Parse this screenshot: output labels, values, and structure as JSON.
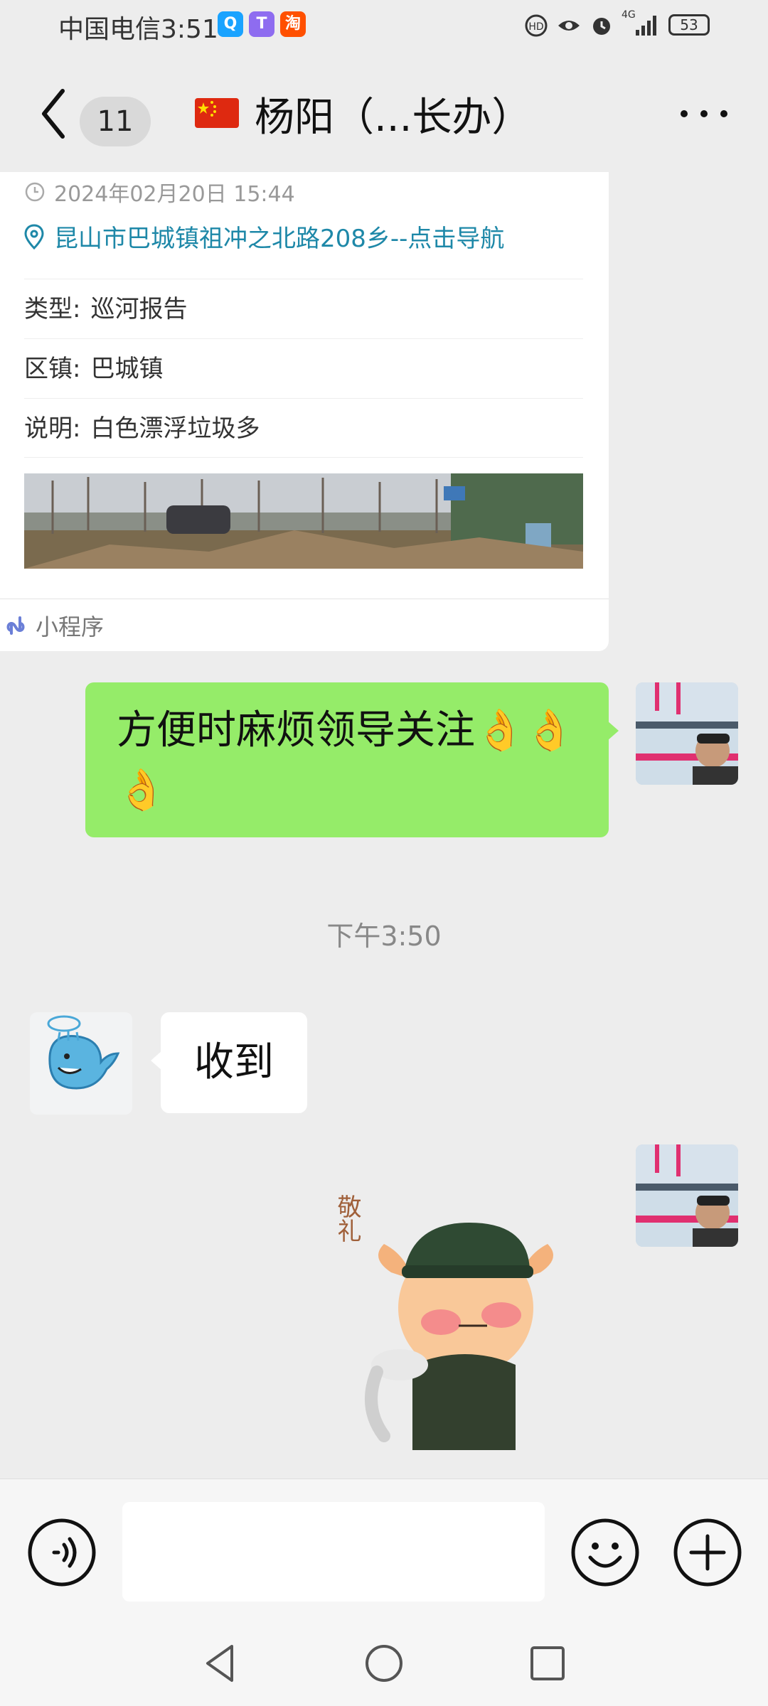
{
  "status_bar": {
    "carrier_time": "中国电信3:51",
    "battery": "53",
    "app_badges": [
      {
        "name": "search-app",
        "color": "#1aa3ff",
        "glyph": "Q"
      },
      {
        "name": "colorful-app",
        "color": "#8e6cf0",
        "glyph": "T"
      },
      {
        "name": "taobao-app",
        "color": "#ff5000",
        "glyph": "淘"
      }
    ],
    "network": "4G"
  },
  "header": {
    "back_icon": "chevron-left-icon",
    "unread_count": "11",
    "title": "杨阳（...长办）",
    "flag": "china-flag-icon",
    "more_icon": "more-dots-icon"
  },
  "mini_program_card": {
    "datetime": "2024年02月20日 15:44",
    "location": "昆山市巴城镇祖冲之北路208乡--点击导航",
    "rows": [
      {
        "label": "类型:",
        "value": "巡河报告"
      },
      {
        "label": "区镇:",
        "value": "巴城镇"
      },
      {
        "label": "说明:",
        "value": "白色漂浮垃圾多"
      }
    ],
    "footer_label": "小程序"
  },
  "messages": {
    "sent_text": "方便时麻烦领导关注👌👌👌",
    "timestamp": "下午3:50",
    "received_text": "收到",
    "sticker_text": "敬礼"
  },
  "input_bar": {
    "voice_icon": "voice-icon",
    "emoji_icon": "emoji-icon",
    "plus_icon": "plus-icon",
    "placeholder": ""
  },
  "colors": {
    "sent_bubble": "#95ec69",
    "link": "#1e88a8",
    "background": "#ededed"
  }
}
